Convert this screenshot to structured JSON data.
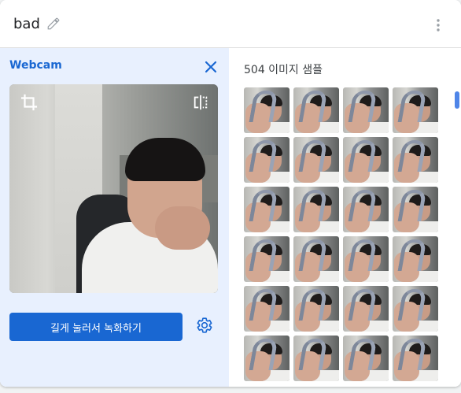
{
  "header": {
    "class_name": "bad"
  },
  "webcam": {
    "title": "Webcam",
    "record_label": "길게 눌러서 녹화하기"
  },
  "samples": {
    "count_label": "504 이미지 샘플",
    "visible_thumbnails": 24
  },
  "icons": [
    "pencil-icon",
    "more-vert-icon",
    "close-icon",
    "crop-icon",
    "flip-icon",
    "settings-icon"
  ],
  "colors": {
    "accent": "#1967d2",
    "panel": "#e8f0fe"
  }
}
